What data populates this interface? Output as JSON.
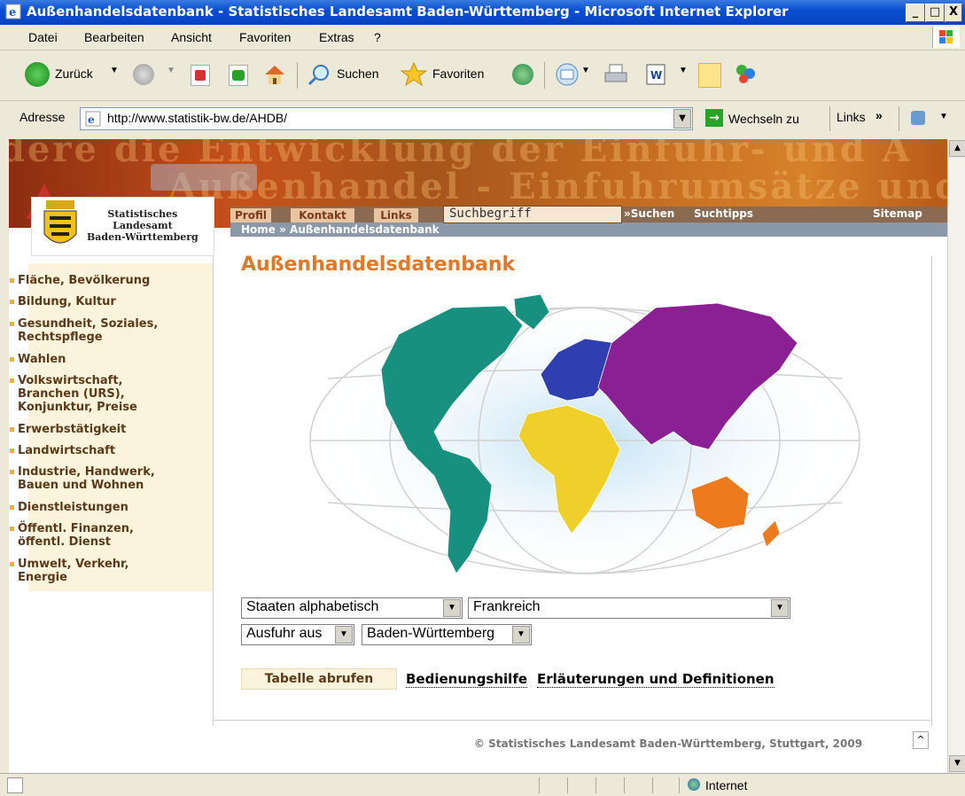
{
  "window": {
    "title": "Außenhandelsdatenbank - Statistisches Landesamt Baden-Württemberg - Microsoft Internet Explorer",
    "minimize": "_",
    "maximize": "□",
    "close": "X"
  },
  "menubar": {
    "items": [
      "Datei",
      "Bearbeiten",
      "Ansicht",
      "Favoriten",
      "Extras",
      "?"
    ]
  },
  "toolbar": {
    "back_label": "Zurück",
    "search_label": "Suchen",
    "favorites_label": "Favoriten"
  },
  "addressbar": {
    "label": "Adresse",
    "url": "http://www.statistik-bw.de/AHDB/",
    "go_label": "Wechseln zu",
    "links_label": "Links",
    "chevron": "»"
  },
  "banner": {
    "bg_text_1": "dere die Entwicklung der Einfuhr- und A",
    "bg_text_2": "Außenhandel - Einfuhrumsätze und",
    "nav": {
      "profil": "Profil",
      "kontakt": "Kontakt",
      "links": "Links"
    },
    "search_placeholder": "Suchbegriff",
    "search_button": "»Suchen",
    "search_tips": "Suchtipps",
    "sitemap": "Sitemap",
    "breadcrumb": "Home » Außenhandelsdatenbank"
  },
  "logo": {
    "line1": "Statistisches",
    "line2": "Landesamt",
    "line3": "Baden-Württemberg"
  },
  "leftnav": {
    "items": [
      "Fläche, Bevölkerung",
      "Bildung, Kultur",
      "Gesundheit, Soziales,\nRechtspflege",
      "Wahlen",
      "Volkswirtschaft,\nBranchen (URS),\nKonjunktur, Preise",
      "Erwerbstätigkeit",
      "Landwirtschaft",
      "Industrie, Handwerk,\nBauen und Wohnen",
      "Dienstleistungen",
      "Öffentl. Finanzen,\nöffentl. Dienst",
      "Umwelt, Verkehr,\nEnergie"
    ]
  },
  "main": {
    "title": "Außenhandelsdatenbank",
    "select_type": "Staaten alphabetisch",
    "select_country": "Frankreich",
    "select_direction": "Ausfuhr aus",
    "select_region": "Baden-Württemberg",
    "button_table": "Tabelle abrufen",
    "link_help": "Bedienungshilfe",
    "link_defs": "Erläuterungen und Definitionen",
    "footer": "© Statistisches Landesamt Baden-Württemberg, Stuttgart, 2009",
    "map_colors": {
      "americas": "#17907f",
      "europe": "#2f3fb0",
      "asia": "#8b1f94",
      "africa": "#efcf2a",
      "oceania": "#ee7a1e",
      "glow": "#9ccbe8"
    }
  },
  "statusbar": {
    "zone": "Internet"
  }
}
